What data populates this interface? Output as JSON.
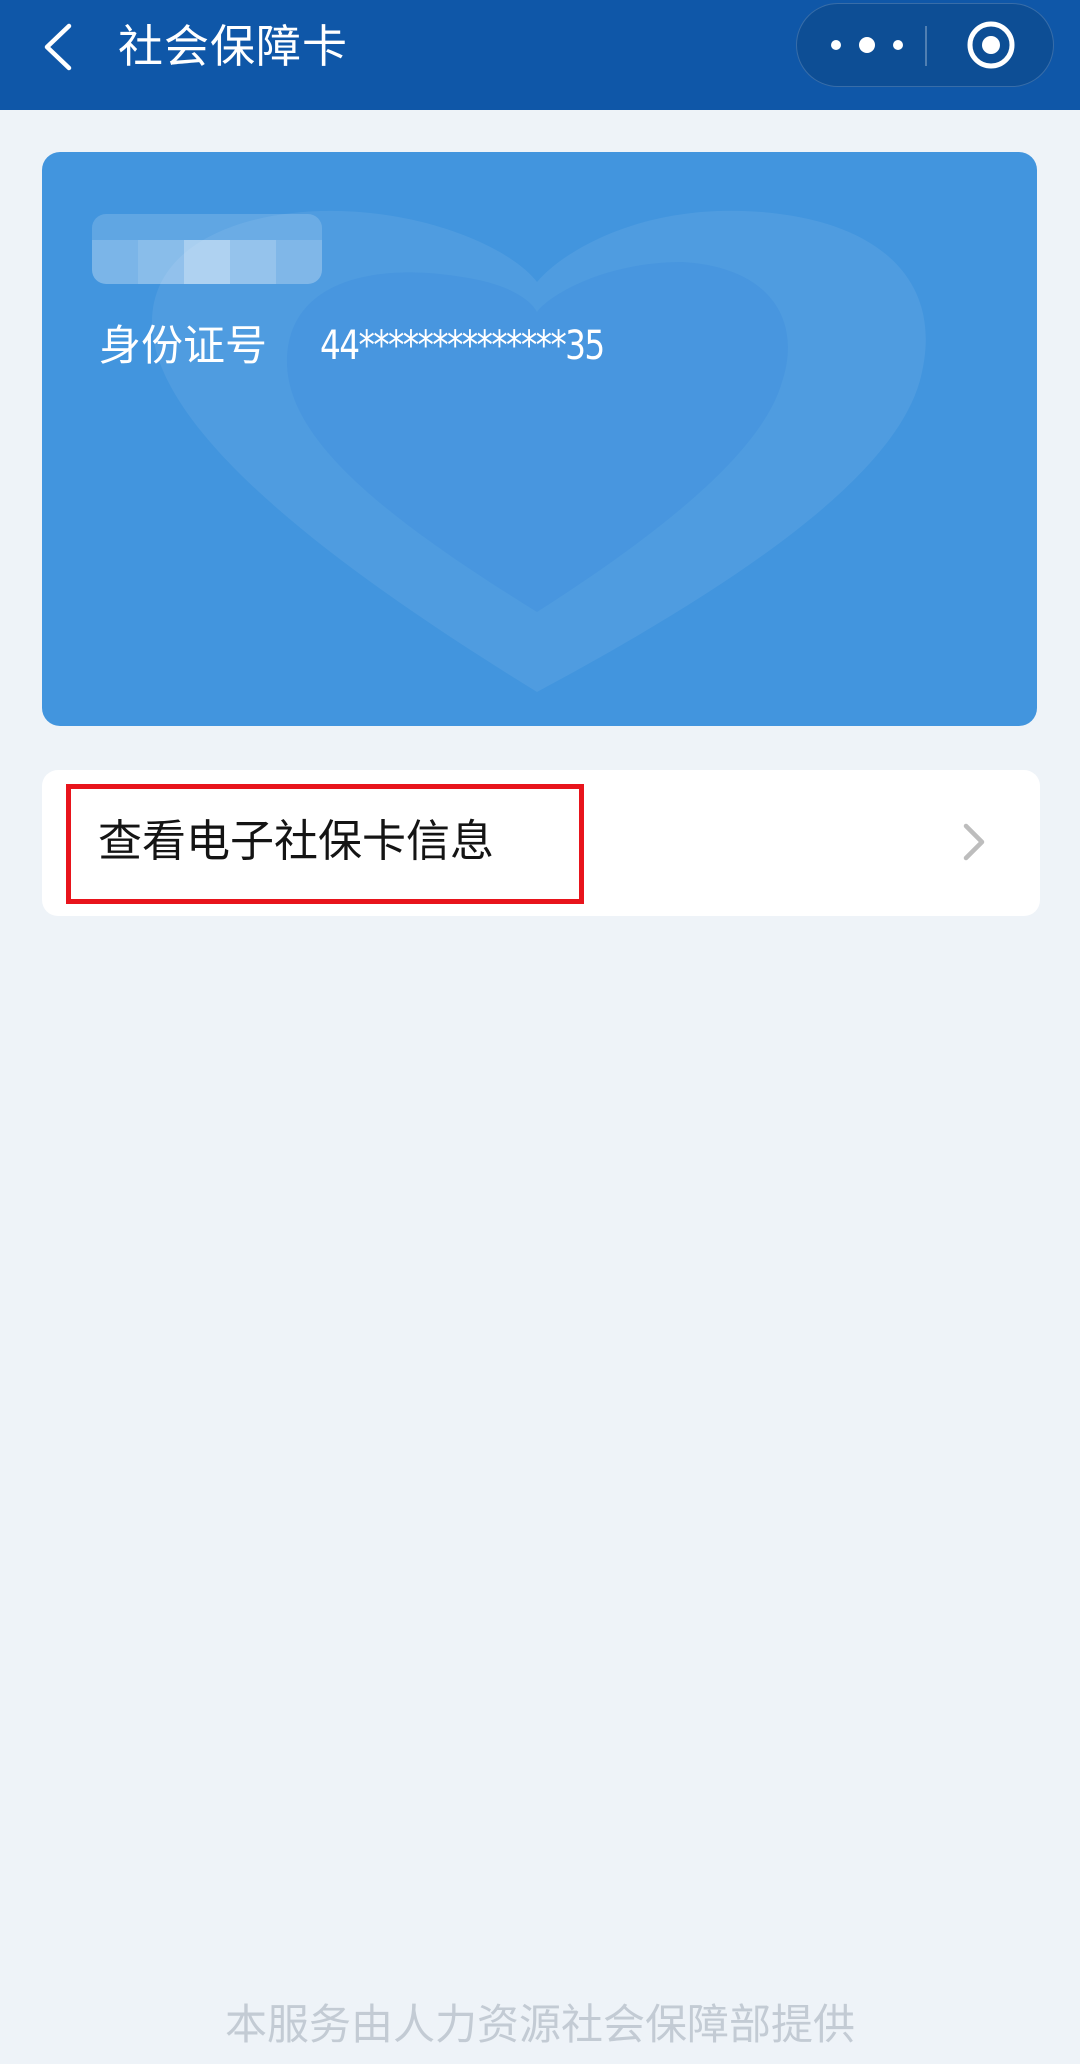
{
  "navbar": {
    "title": "社会保障卡",
    "back_icon": "chevron-left-icon",
    "more_icon": "more-dots-icon",
    "close_icon": "target-circle-icon",
    "background": "#0f57a8"
  },
  "card": {
    "id_label": "身份证号",
    "id_value": "44**************35",
    "background": "#4295de"
  },
  "menu": {
    "items": [
      {
        "label": "查看电子社保卡信息",
        "icon": "chevron-right-icon"
      }
    ],
    "highlight_color": "#e8141c"
  },
  "footer": {
    "text": "本服务由人力资源社会保障部提供"
  }
}
